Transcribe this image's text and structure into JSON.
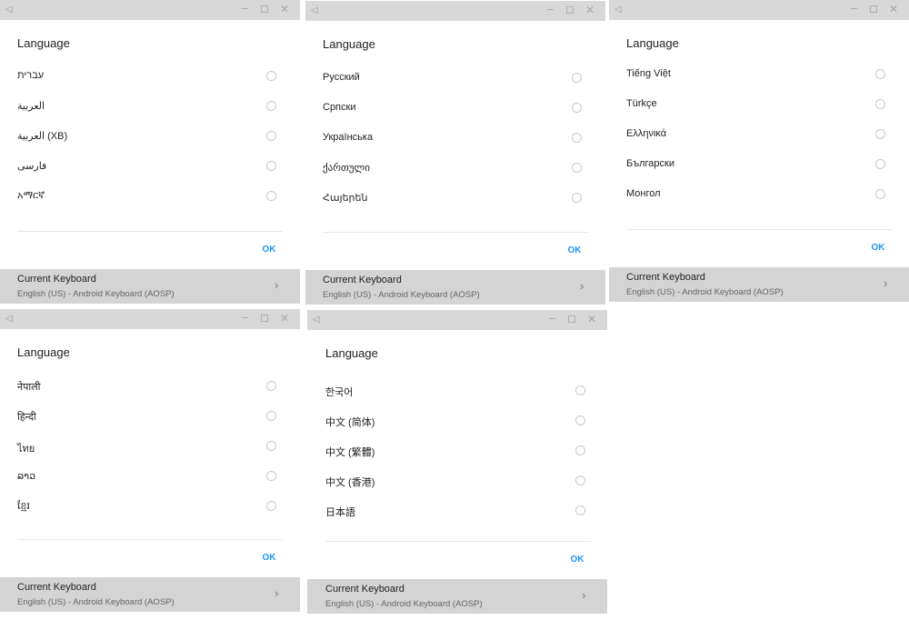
{
  "titlebar": {
    "back_glyph": "◁",
    "minimize_icon": "minimize-icon",
    "maximize_icon": "maximize-icon",
    "close_glyph": "✕"
  },
  "dialogs": [
    {
      "title": "Language",
      "languages": [
        "עברית",
        "العربية",
        "العربية (XB)",
        "فارسی",
        "አማርኛ"
      ],
      "ok_label": "OK",
      "keyboard": {
        "title": "Current Keyboard",
        "subtitle": "English (US) - Android Keyboard (AOSP)",
        "chevron": "›"
      }
    },
    {
      "title": "Language",
      "languages": [
        "Русский",
        "Српски",
        "Українська",
        "ქართული",
        "Հայերեն"
      ],
      "ok_label": "OK",
      "keyboard": {
        "title": "Current Keyboard",
        "subtitle": "English (US) - Android Keyboard (AOSP)",
        "chevron": "›"
      }
    },
    {
      "title": "Language",
      "languages": [
        "Tiếng Việt",
        "Türkçe",
        "Ελληνικά",
        "Български",
        "Монгол"
      ],
      "ok_label": "OK",
      "keyboard": {
        "title": "Current Keyboard",
        "subtitle": "English (US) - Android Keyboard (AOSP)",
        "chevron": "›"
      }
    },
    {
      "title": "Language",
      "languages": [
        "नेपाली",
        "हिन्दी",
        "ไทย",
        "ລາວ",
        "ខ្មែរ"
      ],
      "ok_label": "OK",
      "keyboard": {
        "title": "Current Keyboard",
        "subtitle": "English (US) - Android Keyboard (AOSP)",
        "chevron": "›"
      }
    },
    {
      "title": "Language",
      "languages": [
        "한국어",
        "中文 (简体)",
        "中文 (繁體)",
        "中文 (香港)",
        "日本語"
      ],
      "ok_label": "OK",
      "keyboard": {
        "title": "Current Keyboard",
        "subtitle": "English (US) - Android Keyboard (AOSP)",
        "chevron": "›"
      }
    }
  ],
  "colors": {
    "accent": "#2196f3",
    "titlebar_bg": "#d8d8d8",
    "keyboard_bar_bg": "#d4d4d4",
    "divider": "#e7e7e7"
  }
}
